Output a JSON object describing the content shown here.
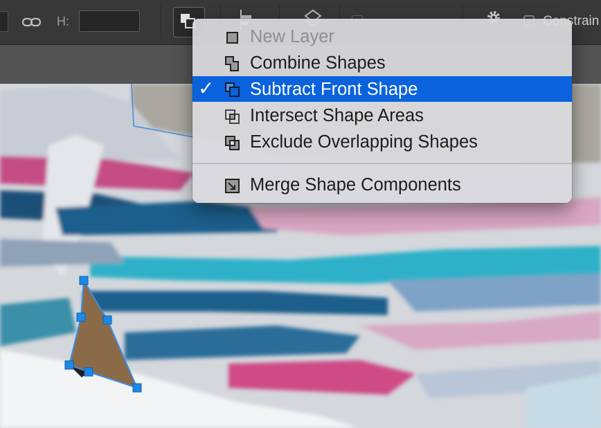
{
  "options_bar": {
    "height_label": "H:",
    "height_value": "",
    "constrain_label": "Constrain"
  },
  "path_operations_menu": {
    "items": [
      {
        "label": "New Layer",
        "icon": "new-layer-icon",
        "enabled": false,
        "checked": false
      },
      {
        "label": "Combine Shapes",
        "icon": "combine-shapes-icon",
        "enabled": true,
        "checked": false
      },
      {
        "label": "Subtract Front Shape",
        "icon": "subtract-front-shape-icon",
        "enabled": true,
        "checked": true
      },
      {
        "label": "Intersect Shape Areas",
        "icon": "intersect-shape-areas-icon",
        "enabled": true,
        "checked": false
      },
      {
        "label": "Exclude Overlapping Shapes",
        "icon": "exclude-overlapping-shapes-icon",
        "enabled": true,
        "checked": false
      },
      {
        "label": "Merge Shape Components",
        "icon": "merge-shape-components-icon",
        "enabled": true,
        "checked": false
      }
    ],
    "check_mark": "✓",
    "selection_color": "#0a62dc"
  },
  "colors": {
    "path_anchor": "#1e88e5",
    "toolbar_bg": "#383838",
    "document_bar_bg": "#535353"
  }
}
